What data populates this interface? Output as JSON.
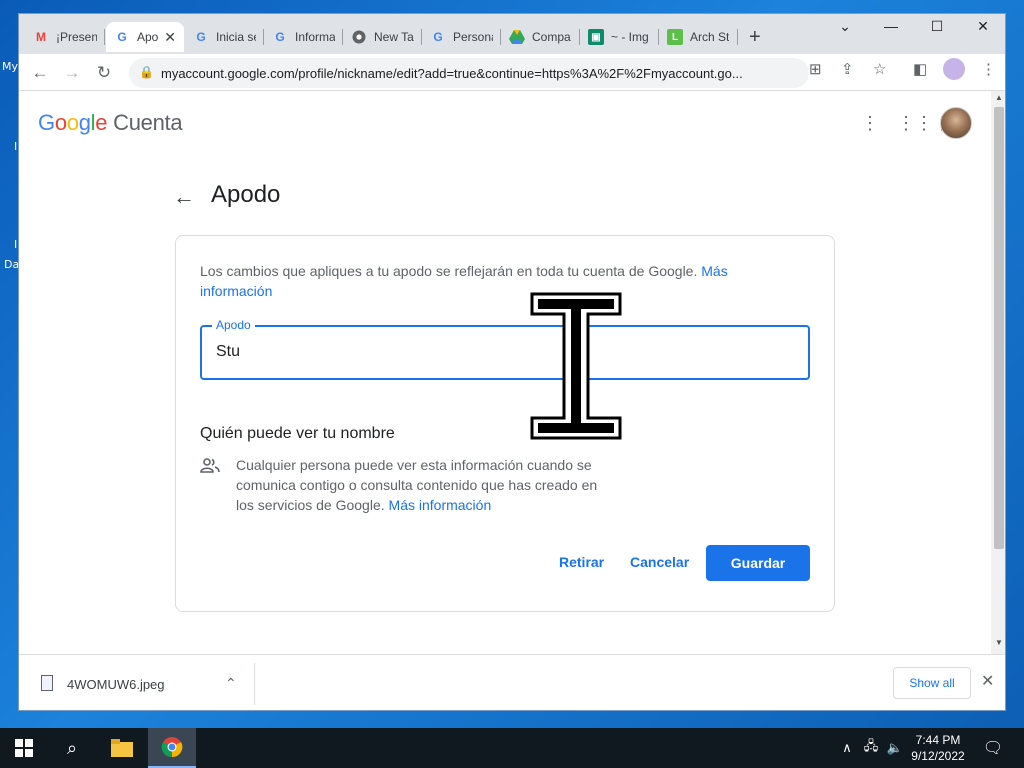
{
  "desktop": {
    "labels": [
      "My",
      "I",
      "I",
      "Da"
    ]
  },
  "browser": {
    "tabs": [
      {
        "title": "¡Presen",
        "icon": "gmail-icon"
      },
      {
        "title": "Apo",
        "icon": "google-icon",
        "active": true
      },
      {
        "title": "Inicia se",
        "icon": "google-icon"
      },
      {
        "title": "Informa",
        "icon": "google-icon"
      },
      {
        "title": "New Ta",
        "icon": "chrome-icon"
      },
      {
        "title": "Persona",
        "icon": "google-icon"
      },
      {
        "title": "Compa",
        "icon": "drive-icon"
      },
      {
        "title": "~ - Img",
        "icon": "image-icon"
      },
      {
        "title": "Arch St",
        "icon": "arch-icon"
      }
    ],
    "new_tab_label": "+",
    "url": "myaccount.google.com/profile/nickname/edit?add=true&continue=https%3A%2F%2Fmyaccount.go..."
  },
  "page": {
    "logo_google": [
      "G",
      "o",
      "o",
      "g",
      "l",
      "e"
    ],
    "logo_suffix": "Cuenta",
    "title": "Apodo",
    "description": "Los cambios que apliques a tu apodo se reflejarán en toda tu cuenta de Google.",
    "description_link": "Más información",
    "field_label": "Apodo",
    "field_value": "Stu",
    "who_title": "Quién puede ver tu nombre",
    "who_text": "Cualquier persona puede ver esta información cuando se comunica contigo o consulta contenido que has creado en los servicios de Google.",
    "who_link": "Más información",
    "buttons": {
      "remove": "Retirar",
      "cancel": "Cancelar",
      "save": "Guardar"
    }
  },
  "download": {
    "file_name": "4WOMUW6.jpeg",
    "show_all": "Show all"
  },
  "taskbar": {
    "time": "7:44 PM",
    "date": "9/12/2022"
  },
  "colors": {
    "accent": "#1a73e8",
    "desktop": "#1a74c9"
  }
}
